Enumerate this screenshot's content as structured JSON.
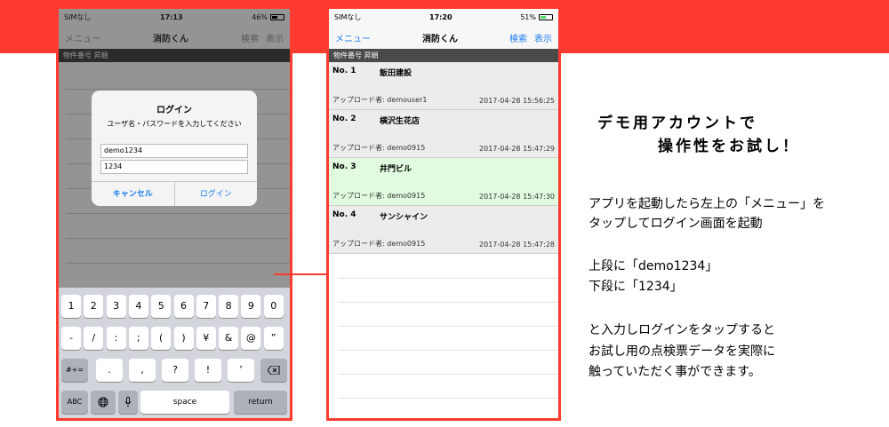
{
  "colors": {
    "accent_red": "#ff3b30",
    "ios_blue": "#1a7cf2",
    "highlight_green": "#e0fbe0"
  },
  "left_phone": {
    "status": {
      "carrier": "SIMなし",
      "time": "17:13",
      "battery": "46%",
      "battery_level": 0.46
    },
    "nav": {
      "left": "メニュー",
      "title": "消防くん",
      "search": "検索",
      "display": "表示"
    },
    "section_header": "物件番号 昇順",
    "dialog": {
      "title": "ログイン",
      "message": "ユーザ名・パスワードを入力してください",
      "username_value": "demo1234",
      "password_value": "1234",
      "cancel_label": "キャンセル",
      "login_label": "ログイン"
    },
    "keyboard": {
      "row1": [
        "1",
        "2",
        "3",
        "4",
        "5",
        "6",
        "7",
        "8",
        "9",
        "0"
      ],
      "row2": [
        "-",
        "/",
        ":",
        ";",
        "(",
        ")",
        "¥",
        "&",
        "@",
        "”"
      ],
      "row3_left": "#+=",
      "row3": [
        ".",
        ",",
        "?",
        "!",
        "’"
      ],
      "abc": "ABC",
      "space": "space",
      "return": "return"
    }
  },
  "right_phone": {
    "status": {
      "carrier": "SIMなし",
      "time": "17:20",
      "battery": "51%",
      "battery_level": 0.51
    },
    "nav": {
      "left": "メニュー",
      "title": "消防くん",
      "search": "検索",
      "display": "表示"
    },
    "section_header": "物件番号 昇順",
    "items": [
      {
        "no": "No. 1",
        "name": "飯田建設",
        "uploader": "アップロード者: demouser1",
        "date": "2017-04-28 15:56:25"
      },
      {
        "no": "No. 2",
        "name": "横沢生花店",
        "uploader": "アップロード者: demo0915",
        "date": "2017-04-28 15:47:29"
      },
      {
        "no": "No. 3",
        "name": "井門ビル",
        "uploader": "アップロード者: demo0915",
        "date": "2017-04-28 15:47:30"
      },
      {
        "no": "No. 4",
        "name": "サンシャイン",
        "uploader": "アップロード者: demo0915",
        "date": "2017-04-28 15:47:28"
      }
    ]
  },
  "instructions": {
    "heading_line1": "デモ用アカウントで",
    "heading_line2": "操作性をお試し！",
    "p1_line1": "アプリを起動したら左上の「メニュー」を",
    "p1_line2": "タップしてログイン画面を起動",
    "p2_line1": "上段に「demo1234」",
    "p2_line2": "下段に「1234」",
    "p3_line1": "と入力しログインをタップすると",
    "p3_line2": "お試し用の点検票データを実際に",
    "p3_line3": "触っていただく事ができます。"
  }
}
